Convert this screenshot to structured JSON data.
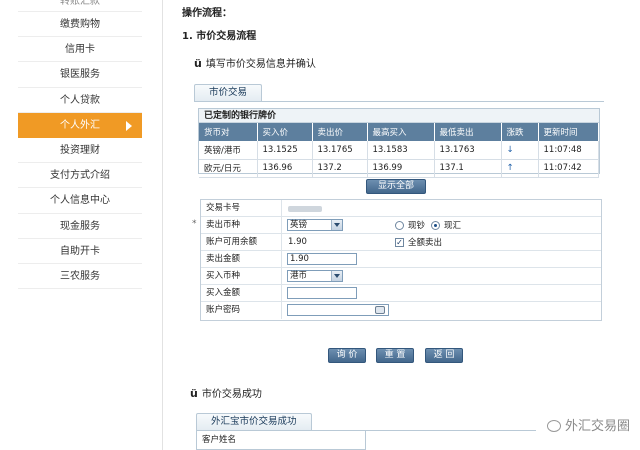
{
  "sidebar": {
    "items": [
      {
        "label": "转账汇款",
        "state": "clipped"
      },
      {
        "label": "缴费购物"
      },
      {
        "label": "信用卡"
      },
      {
        "label": "银医服务"
      },
      {
        "label": "个人贷款"
      },
      {
        "label": "个人外汇",
        "state": "active"
      },
      {
        "label": "投资理财"
      },
      {
        "label": "支付方式介绍"
      },
      {
        "label": "个人信息中心"
      },
      {
        "label": "现金服务"
      },
      {
        "label": "自助开卡"
      },
      {
        "label": "三农服务"
      }
    ]
  },
  "main": {
    "section_title": "操作流程：",
    "step_title": "1. 市价交易流程",
    "step1_mark": "ü",
    "step1_text": "填写市价交易信息并确认",
    "tab_label": "市价交易",
    "rates_panel_title": "已定制的银行牌价",
    "rates_table": {
      "headers": [
        "货币对",
        "买入价",
        "卖出价",
        "最高买入",
        "最低卖出",
        "涨跌",
        "更新时间"
      ],
      "rows": [
        [
          "英镑/港币",
          "13.1525",
          "13.1765",
          "13.1583",
          "13.1763",
          "↓",
          "11:07:48"
        ],
        [
          "欧元/日元",
          "136.96",
          "137.2",
          "136.99",
          "137.1",
          "↑",
          "11:07:42"
        ]
      ]
    },
    "show_all_button": "显示全部",
    "form": {
      "card_label": "交易卡号",
      "sell_currency_label": "卖出币种",
      "sell_currency_value": "英镑",
      "cash_option": "现钞",
      "remit_option": "现汇",
      "selected_option": "现汇",
      "balance_label": "账户可用余额",
      "balance_value": "1.90",
      "sell_all_label": "全额卖出",
      "sell_all_checked": true,
      "sell_amount_label": "卖出金额",
      "sell_amount_value": "1.90",
      "buy_currency_label": "买入币种",
      "buy_currency_value": "港币",
      "buy_amount_label": "买入金额",
      "buy_amount_value": "",
      "password_label": "账户密码",
      "required_mark": "*"
    },
    "buttons": {
      "quote": "询 价",
      "reset": "重 置",
      "back": "返 回"
    },
    "step2_mark": "ü",
    "step2_text": "市价交易成功",
    "result_tab": "外汇宝市价交易成功",
    "result_row_label": "客户姓名"
  },
  "watermark": {
    "text": "外汇交易圈"
  },
  "colors": {
    "accent_orange": "#f09a25",
    "table_header": "#5d7f9e",
    "button": "#43678c"
  }
}
